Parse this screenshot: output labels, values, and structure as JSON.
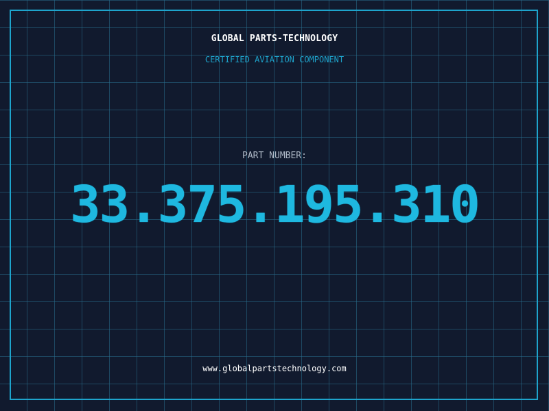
{
  "brand": {
    "company": "GLOBAL PARTS-TECHNOLOGY",
    "tagline": "CERTIFIED AVIATION COMPONENT"
  },
  "part": {
    "label": "PART NUMBER:",
    "number": "33.375.195.310"
  },
  "footer": {
    "website": "www.globalpartstechnology.com"
  },
  "colors": {
    "background": "#111a2e",
    "grid": "#286e8c",
    "accent": "#1ea4cc",
    "part_number": "#1eb8e0",
    "label": "#aeb8c6",
    "text": "#ffffff"
  }
}
